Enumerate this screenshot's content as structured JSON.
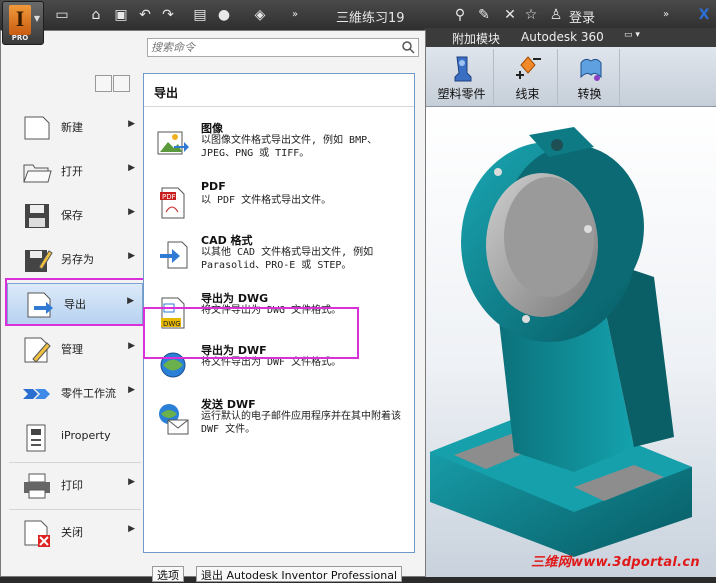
{
  "titlebar": {
    "doc_title": "三維练习19",
    "login": "登录",
    "app_logo_letter": "I",
    "app_logo_sub": "PRO"
  },
  "ribbon": {
    "tabs": [
      "附加模块",
      "Autodesk 360"
    ],
    "buttons": [
      "塑料零件",
      "线束",
      "转换"
    ]
  },
  "search": {
    "placeholder": "搜索命令"
  },
  "left_menu": [
    {
      "label": "新建",
      "icon": "new-doc-icon",
      "has_arrow": true
    },
    {
      "label": "打开",
      "icon": "open-folder-icon",
      "has_arrow": true
    },
    {
      "label": "保存",
      "icon": "save-icon",
      "has_arrow": true
    },
    {
      "label": "另存为",
      "icon": "save-as-icon",
      "has_arrow": true
    },
    {
      "label": "导出",
      "icon": "export-icon",
      "has_arrow": true,
      "active": true
    },
    {
      "label": "管理",
      "icon": "manage-icon",
      "has_arrow": true
    },
    {
      "label": "零件工作流",
      "icon": "workflow-icon",
      "has_arrow": true
    },
    {
      "label": "iProperty",
      "icon": "iproperty-icon",
      "has_arrow": false
    },
    {
      "label": "打印",
      "icon": "print-icon",
      "has_arrow": true
    },
    {
      "label": "关闭",
      "icon": "close-doc-icon",
      "has_arrow": true
    }
  ],
  "submenu": {
    "title": "导出",
    "items": [
      {
        "title": "图像",
        "desc": "以图像文件格式导出文件, 例如 BMP、JPEG、PNG 或 TIFF。",
        "icon": "image-export-icon"
      },
      {
        "title": "PDF",
        "desc": "以 PDF 文件格式导出文件。",
        "icon": "pdf-icon"
      },
      {
        "title": "CAD 格式",
        "desc": "以其他 CAD 文件格式导出文件, 例如 Parasolid、PRO-E 或 STEP。",
        "icon": "cad-format-icon"
      },
      {
        "title": "导出为 DWG",
        "desc": "将文件导出为 DWG 文件格式。",
        "icon": "dwg-icon"
      },
      {
        "title": "导出为 DWF",
        "desc": "将文件导出为 DWF 文件格式。",
        "icon": "dwf-icon"
      },
      {
        "title": "发送 DWF",
        "desc": "运行默认的电子邮件应用程序并在其中附着该 DWF 文件。",
        "icon": "send-dwf-icon"
      }
    ]
  },
  "bottom_buttons": [
    "选项",
    "退出 Autodesk Inventor Professional"
  ],
  "watermark": "三维网www.3dportal.cn",
  "colors": {
    "highlight": "#d930d9",
    "model": "#0e8a95",
    "watermark": "#e01919"
  }
}
